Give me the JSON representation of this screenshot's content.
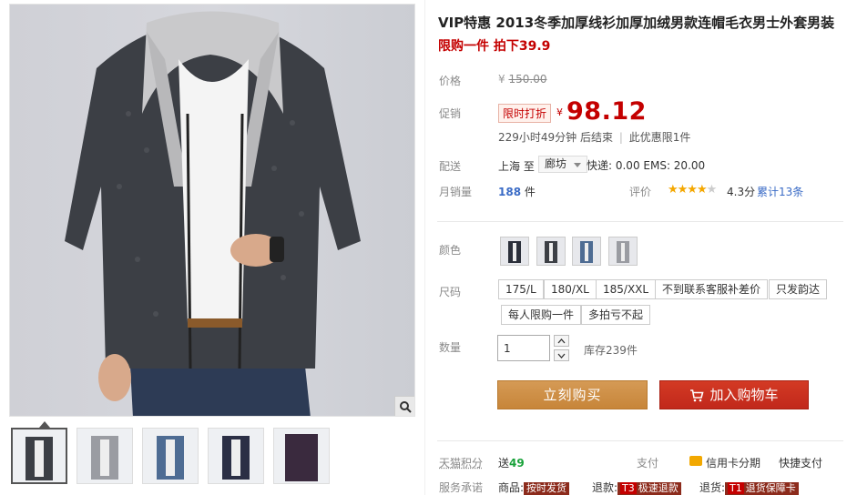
{
  "product": {
    "title": "VIP特惠 2013冬季加厚线衫加厚加绒男款连帽毛衣男士外套男装",
    "subtitle": "限购一件 拍下39.9"
  },
  "price": {
    "label": "价格",
    "currency": "¥",
    "original": "150.00",
    "promo_label": "促销",
    "promo_tag": "限时打折",
    "promo_price": "98.12",
    "countdown": "229小时49分钟 后结束",
    "limit": "此优惠限1件"
  },
  "shipping": {
    "label": "配送",
    "from": "上海 至",
    "to": "廊坊",
    "fee": "快递: 0.00 EMS: 20.00"
  },
  "sales": {
    "label": "月销量",
    "count": "188",
    "unit": "件",
    "rating_label": "评价",
    "stars": "★★★★",
    "stars_dim": "★",
    "score": "4.3分",
    "reviews": "累计13条"
  },
  "options": {
    "color_label": "颜色",
    "size_label": "尺码",
    "sizes": [
      "175/L",
      "180/XL",
      "185/XXL",
      "不到联系客服补差价",
      "只发韵达",
      "每人限购一件",
      "多拍亏不起"
    ]
  },
  "quantity": {
    "label": "数量",
    "value": "1",
    "stock": "库存239件"
  },
  "actions": {
    "buy": "立刻购买",
    "cart": "加入购物车"
  },
  "footer": {
    "points_label": "天猫积分",
    "points_prefix": "送",
    "points_value": "49",
    "pay_label": "支付",
    "credit": "信用卡分期",
    "quickpay": "快捷支付",
    "service_label": "服务承诺",
    "svc1_prefix": "商品:",
    "svc1_badge": "按时发货",
    "svc2_prefix": "退款:",
    "svc2_t": "T3",
    "svc2_badge": "极速退款",
    "svc3_prefix": "退货:",
    "svc3_t": "T1",
    "svc3_badge": "退货保障卡"
  },
  "colors": {
    "accent": "#c40000",
    "buy_button": "#c78539",
    "cart_button": "#c1281b",
    "link": "#3a6bc6"
  },
  "icons": {
    "zoom": "magnifier-icon",
    "cart": "shopping-cart-icon",
    "up": "chevron-up-icon",
    "down": "chevron-down-icon"
  }
}
